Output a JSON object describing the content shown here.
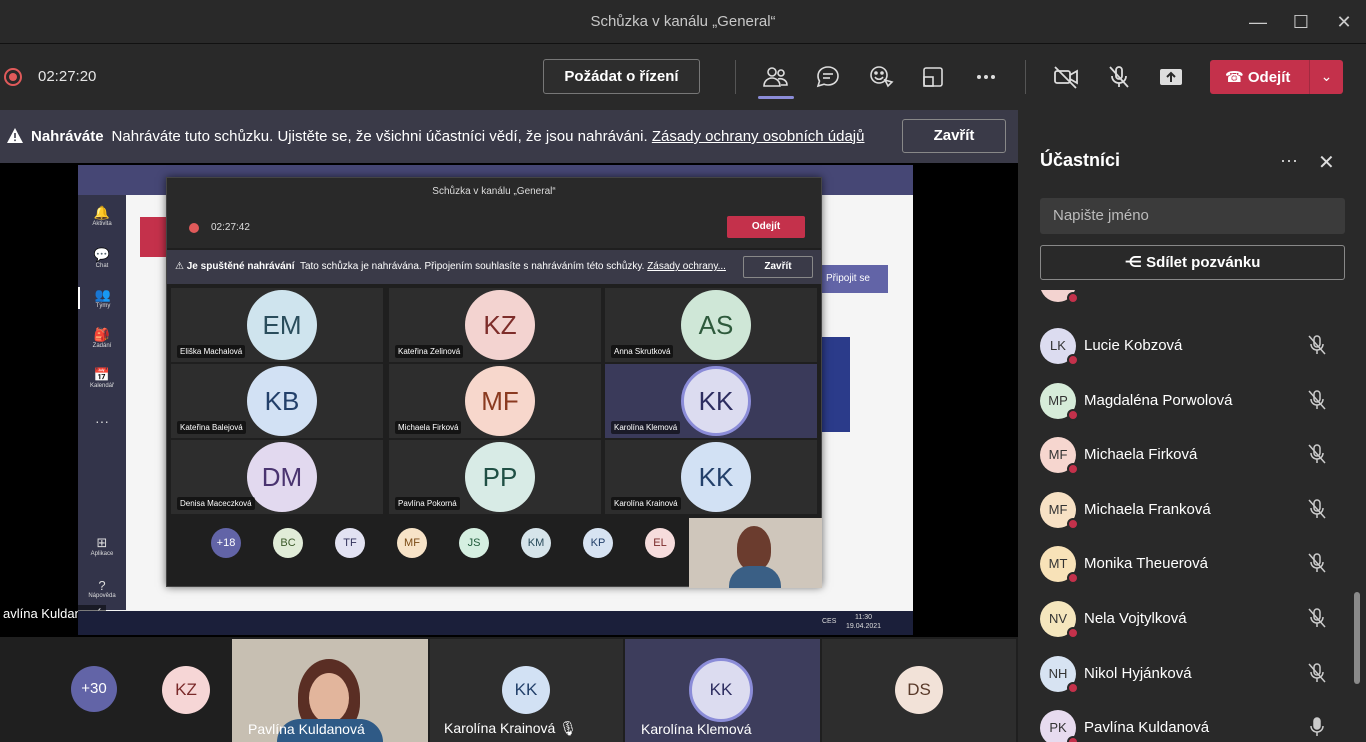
{
  "window": {
    "title": "Schůzka v kanálu „General“"
  },
  "toolbar": {
    "timer": "02:27:20",
    "request_control": "Požádat o řízení",
    "leave": "Odejít"
  },
  "banner": {
    "title": "Nahráváte",
    "text": "Nahráváte tuto schůzku. Ujistěte se, že všichni účastníci vědí, že jsou nahráváni.",
    "link": "Zásady ochrany osobních údajů",
    "close": "Zavřít"
  },
  "inner": {
    "title": "Schůzka v kanálu „General“",
    "timer": "02:27:42",
    "leave": "Odejít",
    "banner_title": "Je spuštěné nahrávání",
    "banner_text": "Tato schůzka je nahrávána. Připojením souhlasíte s nahráváním této schůzky.",
    "banner_link": "Zásady ochrany...",
    "close": "Zavřít",
    "join": "Připojit se",
    "rail": [
      "Aktivita",
      "Chat",
      "Týmy",
      "Zadání",
      "Kalendář",
      "Aplikace",
      "Nápověda"
    ],
    "tiles": [
      {
        "initials": "EM",
        "name": "Eliška Machalová",
        "bg": "#cfe4ee",
        "fg": "#2a4d5c"
      },
      {
        "initials": "KZ",
        "name": "Kateřina Zelinová",
        "bg": "#f3d3d0",
        "fg": "#7d2d2a"
      },
      {
        "initials": "AS",
        "name": "Anna Skrutková",
        "bg": "#cfe7d7",
        "fg": "#2e5a3c"
      },
      {
        "initials": "KB",
        "name": "Kateřina Balejová",
        "bg": "#d2e1f4",
        "fg": "#23406a"
      },
      {
        "initials": "MF",
        "name": "Michaela Firková",
        "bg": "#f7d7cc",
        "fg": "#8a3a20"
      },
      {
        "initials": "KK",
        "name": "Karolína Klemová",
        "bg": "#dcdcf0",
        "fg": "#2d2d60"
      },
      {
        "initials": "DM",
        "name": "Denisa Maceczková",
        "bg": "#e2d9ef",
        "fg": "#4a3470"
      },
      {
        "initials": "PP",
        "name": "Pavlína Pokorná",
        "bg": "#d8ebe6",
        "fg": "#1f4f44"
      },
      {
        "initials": "KK",
        "name": "Karolína Krainová",
        "bg": "#d2e1f4",
        "fg": "#23406a"
      }
    ],
    "small": [
      {
        "t": "+18",
        "bg": "#6264a7",
        "fg": "#fff"
      },
      {
        "t": "BC",
        "bg": "#e1ecd8",
        "fg": "#3c5a2a"
      },
      {
        "t": "TF",
        "bg": "#e2e2f2",
        "fg": "#33335c"
      },
      {
        "t": "MF",
        "bg": "#f7e3c7",
        "fg": "#7a4a14"
      },
      {
        "t": "JS",
        "bg": "#d5efe1",
        "fg": "#1f5a3a"
      },
      {
        "t": "KM",
        "bg": "#d6e4ea",
        "fg": "#284a5a"
      },
      {
        "t": "KP",
        "bg": "#d7e3f2",
        "fg": "#23406a"
      },
      {
        "t": "EL",
        "bg": "#f6dcdc",
        "fg": "#7a2a2a"
      }
    ],
    "clock": "11:30",
    "date": "19.04.2021",
    "lang": "CES"
  },
  "stage_name": "avlína Kuldanová",
  "gallery": [
    {
      "t": "+30",
      "bg": "#6264a7",
      "fg": "#fff"
    },
    {
      "t": "KZ",
      "bg": "#f6d6d6",
      "fg": "#7a2a2a"
    },
    {
      "name": "Pavlína Kuldanová"
    },
    {
      "t": "KK",
      "name": "Karolína Krainová",
      "bg": "#d2e1f4",
      "fg": "#23406a"
    },
    {
      "t": "KK",
      "name": "Karolína Klemová",
      "bg": "#dcdcf0",
      "fg": "#2d2d60"
    },
    {
      "t": "DS",
      "bg": "#f2e2d8",
      "fg": "#5a3a2a"
    }
  ],
  "panel": {
    "title": "Účastníci",
    "search_placeholder": "Napište jméno",
    "invite": "Sdílet pozvánku",
    "people": [
      {
        "i": "LK",
        "name": "Lucie Kobzová",
        "bg": "#dcdcf0",
        "muted": true
      },
      {
        "i": "MP",
        "name": "Magdaléna Porwolová",
        "bg": "#d6ecd9",
        "muted": true
      },
      {
        "i": "MF",
        "name": "Michaela Firková",
        "bg": "#f6d6cf",
        "muted": true
      },
      {
        "i": "MF",
        "name": "Michaela Franková",
        "bg": "#f7e1c4",
        "muted": true
      },
      {
        "i": "MT",
        "name": "Monika Theuerová",
        "bg": "#f8e2b8",
        "muted": true
      },
      {
        "i": "NV",
        "name": "Nela Vojtylková",
        "bg": "#f5e6bd",
        "muted": true
      },
      {
        "i": "NH",
        "name": "Nikol Hyjánková",
        "bg": "#d7e3f2",
        "muted": true
      },
      {
        "i": "PK",
        "name": "Pavlína Kuldanová",
        "bg": "#e7dbef",
        "muted": false
      }
    ]
  }
}
